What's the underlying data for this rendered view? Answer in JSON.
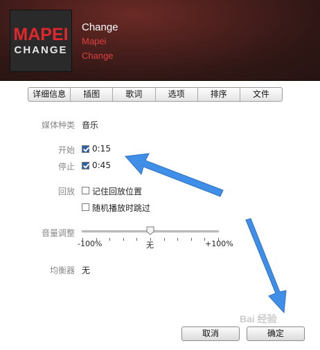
{
  "header": {
    "artwork": {
      "line1": "MAPEI",
      "line2": "CHANGE"
    },
    "title": "Change",
    "artist": "Mapei",
    "album": "Change"
  },
  "tabs": [
    {
      "label": "详细信息"
    },
    {
      "label": "插图"
    },
    {
      "label": "歌词"
    },
    {
      "label": "选项"
    },
    {
      "label": "排序"
    },
    {
      "label": "文件"
    }
  ],
  "options": {
    "media_kind": {
      "label": "媒体种类",
      "value": "音乐"
    },
    "start": {
      "label": "开始",
      "checked": true,
      "value": "0:15"
    },
    "stop": {
      "label": "停止",
      "checked": true,
      "value": "0:45"
    },
    "playback": {
      "label": "回放",
      "remember_position": {
        "label": "记住回放位置",
        "checked": false
      },
      "skip_shuffle": {
        "label": "随机播放时跳过",
        "checked": false
      }
    },
    "volume": {
      "label": "音量调整",
      "min_label": "-100%",
      "mid_label": "无",
      "max_label": "+100%",
      "value_percent": 0
    },
    "equalizer": {
      "label": "均衡器",
      "value": "无"
    }
  },
  "buttons": {
    "cancel": "取消",
    "ok": "确定"
  },
  "watermark": "Bai 经验",
  "colors": {
    "header_bg": "#3a1a18",
    "artist_text": "#e04040",
    "annotation_arrow": "#3f8ee8",
    "checkbox_checked": "#2c5fa8"
  }
}
